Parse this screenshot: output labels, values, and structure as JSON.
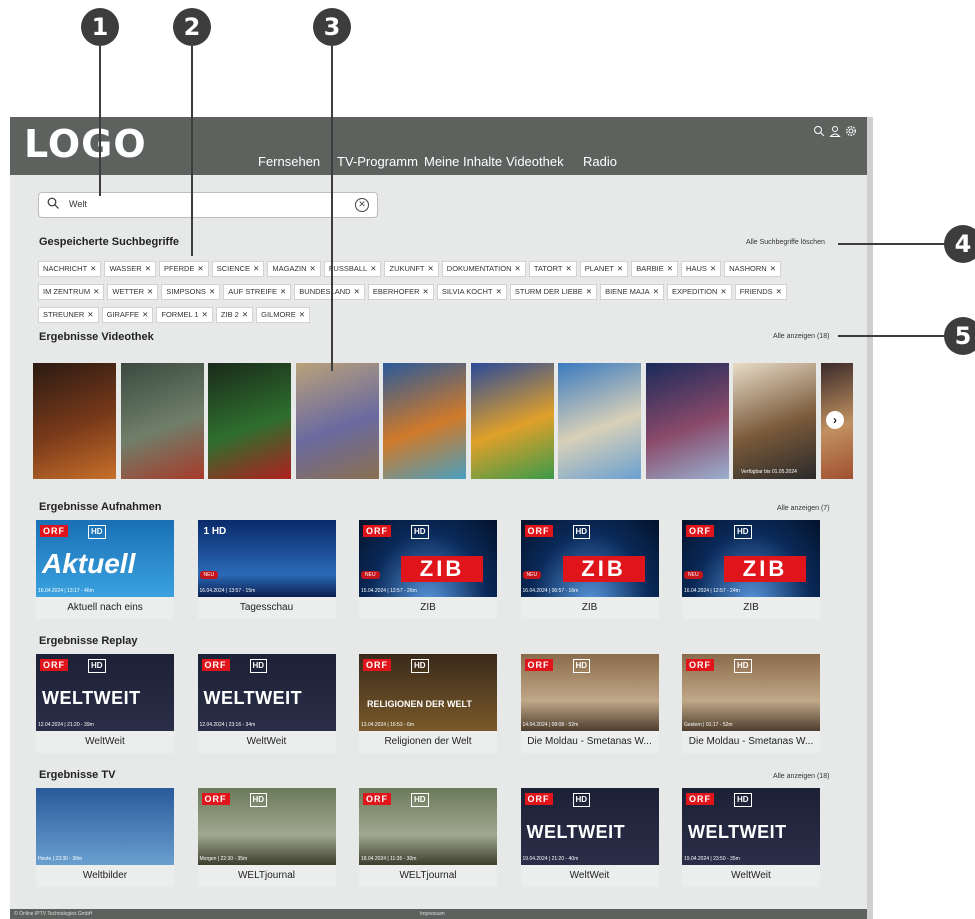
{
  "callouts": [
    "1",
    "2",
    "3",
    "4",
    "5"
  ],
  "header": {
    "logo": "LOGO",
    "nav": [
      "Fernsehen",
      "TV-Programm",
      "Meine Inhalte",
      "Videothek",
      "Radio"
    ],
    "icons": [
      "search-icon",
      "user-icon",
      "settings-icon"
    ]
  },
  "search": {
    "value": "Welt",
    "placeholder": ""
  },
  "saved": {
    "title": "Gespeicherte Suchbegriffe",
    "clear_all": "Alle Suchbegriffe löschen",
    "terms": [
      "NACHRICHT",
      "WASSER",
      "PFERDE",
      "SCIENCE",
      "MAGAZIN",
      "FUSSBALL",
      "ZUKUNFT",
      "DOKUMENTATION",
      "TATORT",
      "PLANET",
      "BARBIE",
      "HAUS",
      "NASHORN",
      "IM ZENTRUM",
      "WETTER",
      "SIMPSONS",
      "AUF STREIFE",
      "BUNDESLAND",
      "EBERHOFER",
      "SILVIA KOCHT",
      "STURM DER LIEBE",
      "BIENE MAJA",
      "EXPEDITION",
      "FRIENDS",
      "STREUNER",
      "GIRAFFE",
      "FORMEL 1",
      "ZIB 2",
      "GILMORE"
    ],
    "remove_glyph": "✕"
  },
  "videothek": {
    "title": "Ergebnisse Videothek",
    "show_all": "Alle anzeigen (18)",
    "poster_note": "Verfügbar bis 01.05.2024",
    "next_glyph": "›"
  },
  "aufnahmen": {
    "title": "Ergebnisse Aufnahmen",
    "show_all": "Alle anzeigen (7)",
    "items": [
      {
        "meta": "16.04.2024 | 13:17 - 46m",
        "title": "Aktuell nach eins",
        "brand": "Aktuell"
      },
      {
        "meta": "16.04.2024 | 13:57 - 15m",
        "title": "Tagesschau",
        "badge": "NEU",
        "brand": "HD"
      },
      {
        "meta": "15.04.2024 | 12:57 - 26m",
        "title": "ZIB",
        "badge": "NEU",
        "brand": "ZIB"
      },
      {
        "meta": "16.04.2024 | 06:57 - 16m",
        "title": "ZIB",
        "badge": "NEU",
        "brand": "ZIB"
      },
      {
        "meta": "16.04.2024 | 12:57 - 24m",
        "title": "ZIB",
        "badge": "NEU",
        "brand": "ZIB"
      }
    ]
  },
  "replay": {
    "title": "Ergebnisse Replay",
    "items": [
      {
        "meta": "12.04.2024 | 21:20 - 39m",
        "title": "WeltWeit",
        "brand": "WELTWEIT"
      },
      {
        "meta": "12.04.2024 | 23:16 - 34m",
        "title": "WeltWeit",
        "brand": "WELTWEIT"
      },
      {
        "meta": "13.04.2024 | 16:53 - 6m",
        "title": "Religionen der Welt",
        "brand": "RELIGIONEN DER WELT"
      },
      {
        "meta": "14.04.2024 | 09:08 - 52m",
        "title": "Die Moldau - Smetanas W..."
      },
      {
        "meta": "Gestern | 01:17 - 52m",
        "title": "Die Moldau - Smetanas W..."
      }
    ]
  },
  "tv": {
    "title": "Ergebnisse TV",
    "show_all": "Alle anzeigen (18)",
    "items": [
      {
        "meta": "Heute | 23:30 - 30m",
        "title": "Weltbilder"
      },
      {
        "meta": "Morgen | 22:30 - 35m",
        "title": "WELTjournal"
      },
      {
        "meta": "18.04.2024 | 11:35 - 30m",
        "title": "WELTjournal"
      },
      {
        "meta": "19.04.2024 | 21:20 - 40m",
        "title": "WeltWeit",
        "brand": "WELTWEIT"
      },
      {
        "meta": "19.04.2024 | 23:50 - 35m",
        "title": "WeltWeit",
        "brand": "WELTWEIT"
      }
    ]
  },
  "channel": {
    "orf": "ORF",
    "hd": "HD",
    "one_hd": "1 HD"
  },
  "footer": {
    "copyright": "© Online IPTV Technologies GmbH",
    "imprint": "Impressum"
  },
  "colors": {
    "header_bg": "#5e625f",
    "page_bg": "#e6e9e8",
    "orf_red": "#e0151b",
    "callout": "#3d3d3d"
  }
}
